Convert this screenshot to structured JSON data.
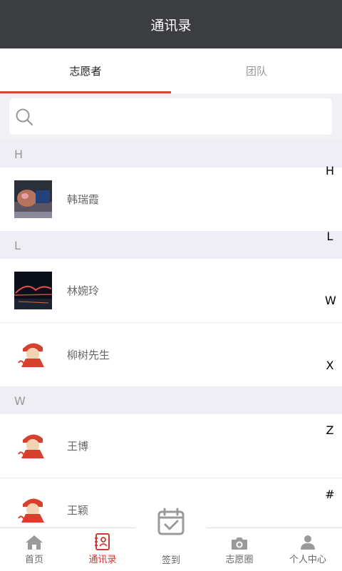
{
  "header": {
    "title": "通讯录"
  },
  "tabs": [
    {
      "label": "志愿者",
      "active": true
    },
    {
      "label": "团队",
      "active": false
    }
  ],
  "search": {
    "placeholder": ""
  },
  "sections": [
    {
      "letter": "H",
      "contacts": [
        {
          "name": "韩瑞霞",
          "avatar": "photo-dark-room"
        }
      ]
    },
    {
      "letter": "L",
      "contacts": [
        {
          "name": "林婉玲",
          "avatar": "photo-night-bridge"
        },
        {
          "name": "柳树先生",
          "avatar": "cartoon-girl-red-hat"
        }
      ]
    },
    {
      "letter": "W",
      "contacts": [
        {
          "name": "王博",
          "avatar": "cartoon-girl-red-hat"
        },
        {
          "name": "王颖",
          "avatar": "cartoon-girl-red-hat"
        }
      ]
    }
  ],
  "index_letters": [
    "H",
    "L",
    "W",
    "X",
    "Z",
    "#"
  ],
  "tabbar": [
    {
      "label": "首页",
      "icon": "home-icon",
      "active": false
    },
    {
      "label": "通讯录",
      "icon": "contacts-icon",
      "active": true
    },
    {
      "label": "签到",
      "icon": "calendar-check-icon",
      "active": false
    },
    {
      "label": "志愿圈",
      "icon": "camera-icon",
      "active": false
    },
    {
      "label": "个人中心",
      "icon": "person-icon",
      "active": false
    }
  ],
  "colors": {
    "accent": "#d24a2e",
    "header": "#3b3d40",
    "active_tab": "#d23636"
  }
}
